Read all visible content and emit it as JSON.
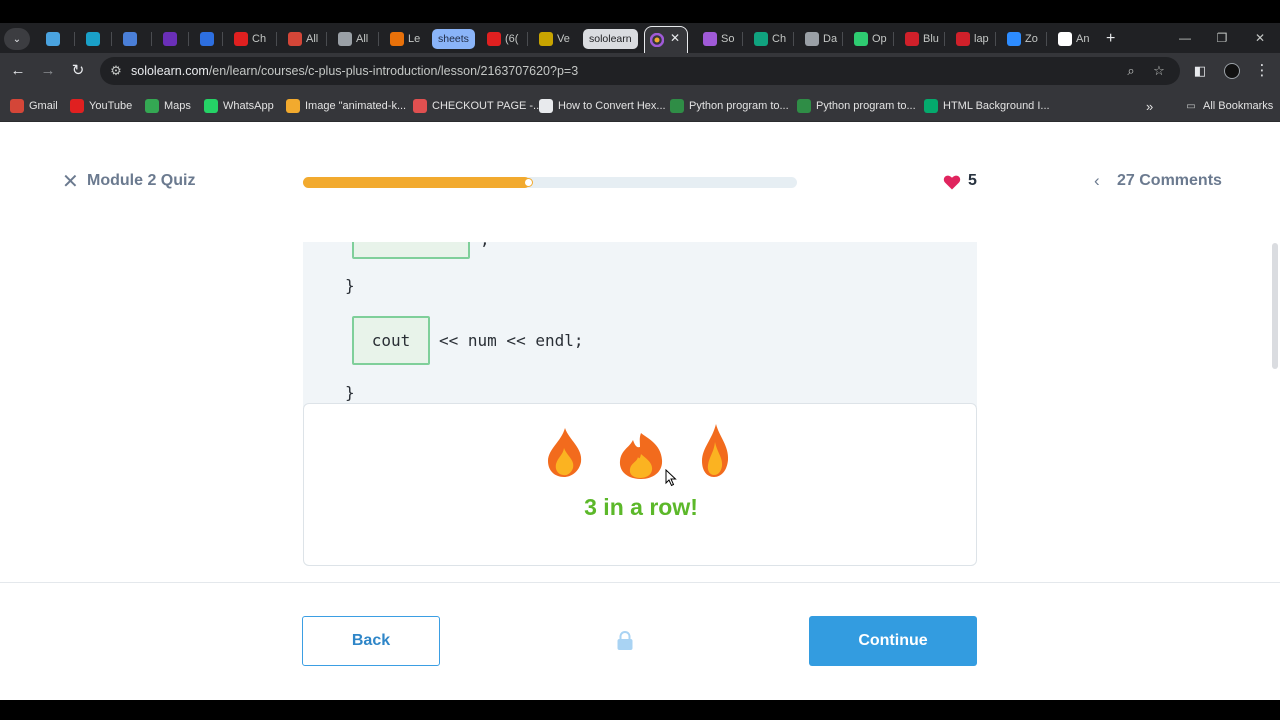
{
  "browser": {
    "tabs": [
      {
        "label": "",
        "icon": "gmail-m-icon",
        "color": "#4aa3df"
      },
      {
        "label": "",
        "icon": "play-icon",
        "color": "#1aa0c8"
      },
      {
        "label": "",
        "icon": "chart-icon",
        "color": "#4a7fd8"
      },
      {
        "label": "",
        "icon": "upwork-icon",
        "color": "#6a2fb8"
      },
      {
        "label": "",
        "icon": "circle-c-icon",
        "color": "#2d6fe0"
      },
      {
        "label": "Ch",
        "icon": "youtube-icon",
        "color": "#e02020"
      },
      {
        "label": "All",
        "icon": "gmail-icon",
        "color": "#d44638"
      },
      {
        "label": "All",
        "icon": "openai-icon",
        "color": "#9aa0a6"
      },
      {
        "label": "Le",
        "icon": "maps-pin-icon",
        "color": "#e8710a"
      },
      {
        "label": "(6(",
        "icon": "youtube-icon",
        "color": "#e02020"
      },
      {
        "label": "Ve",
        "icon": "clock-icon",
        "color": "#c8a400"
      },
      {
        "label": "So",
        "icon": "sololearn-icon",
        "color": "#a05ad8"
      },
      {
        "label": "Ch",
        "icon": "chatgpt-icon",
        "color": "#10a37f"
      },
      {
        "label": "Da",
        "icon": "openai-icon",
        "color": "#9aa0a6"
      },
      {
        "label": "Op",
        "icon": "triangle-icon",
        "color": "#2ecc71"
      },
      {
        "label": "Blu",
        "icon": "letter-l-icon",
        "color": "#d0202a"
      },
      {
        "label": "lap",
        "icon": "circle-l-icon",
        "color": "#d0202a"
      },
      {
        "label": "Zo",
        "icon": "zoom-icon",
        "color": "#2d8cff"
      },
      {
        "label": "An",
        "icon": "amazon-icon",
        "color": "#ffffff"
      }
    ],
    "pill_sheets": "sheets",
    "pill_sololearn": "sololearn",
    "url_host": "sololearn.com",
    "url_path": "/en/learn/courses/c-plus-plus-introduction/lesson/2163707620?p=3",
    "bookmarks": [
      {
        "label": "Gmail",
        "icon": "gmail-icon"
      },
      {
        "label": "YouTube",
        "icon": "youtube-icon"
      },
      {
        "label": "Maps",
        "icon": "maps-icon"
      },
      {
        "label": "WhatsApp",
        "icon": "whatsapp-icon"
      },
      {
        "label": "Image \"animated-k...",
        "icon": "star-icon"
      },
      {
        "label": "CHECKOUT PAGE -...",
        "icon": "lips-icon"
      },
      {
        "label": "How to Convert Hex...",
        "icon": "alpha-icon"
      },
      {
        "label": "Python program to...",
        "icon": "gfg-icon"
      },
      {
        "label": "Python program to...",
        "icon": "gfg-icon"
      },
      {
        "label": "HTML Background I...",
        "icon": "w3-icon"
      }
    ],
    "all_bookmarks": "All Bookmarks"
  },
  "header": {
    "title": "Module 2 Quiz",
    "progress": 0.46,
    "lives": "5",
    "comments": "27 Comments"
  },
  "code": {
    "fragment_comma": ";",
    "close_brace_inner": "}",
    "cout": "cout",
    "rest": "<< num << endl;",
    "close_brace_outer": "}"
  },
  "feedback": {
    "streak": "3 in a row!"
  },
  "footer": {
    "back": "Back",
    "continue": "Continue"
  },
  "colors": {
    "progress_fill": "#f2aa2e",
    "success": "#5cb82a",
    "primary": "#339ce0",
    "heart": "#e0245e"
  }
}
